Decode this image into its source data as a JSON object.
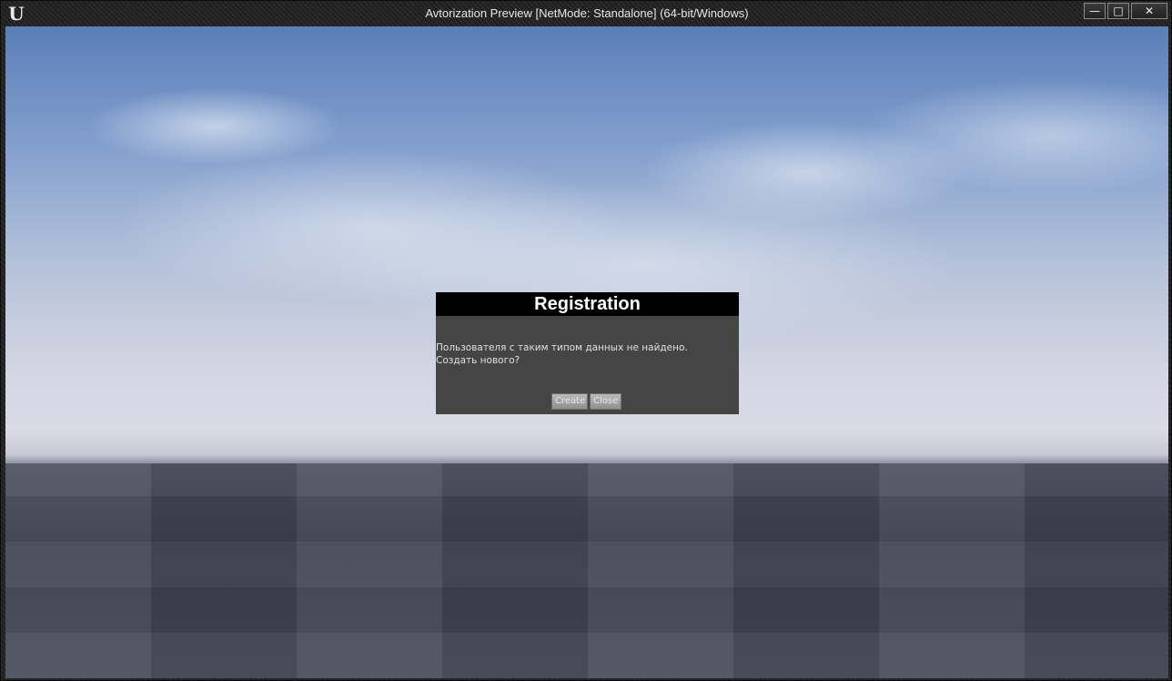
{
  "window": {
    "title": "Avtorization Preview [NetMode: Standalone]  (64-bit/Windows)",
    "logo": "U",
    "controls": {
      "minimize": "—",
      "maximize": "□",
      "close": "✕"
    }
  },
  "dialog": {
    "title": "Registration",
    "message": "Пользователя с таким типом данных не найдено. Создать нового?",
    "create_label": "Create",
    "close_label": "Close"
  },
  "colors": {
    "dialog_bg": "#454545",
    "dialog_header_bg": "#000000",
    "sky_top": "#5a7fb8",
    "floor": "#3d4150"
  }
}
